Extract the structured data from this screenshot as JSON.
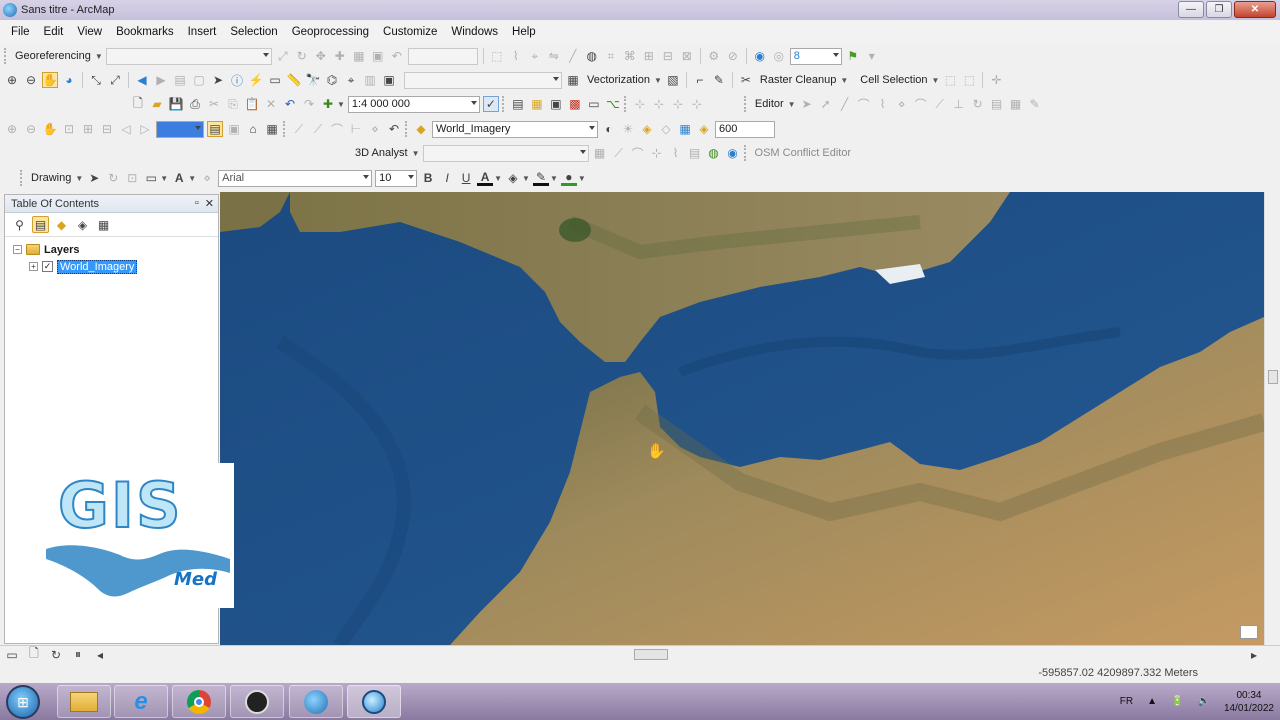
{
  "window": {
    "title": "Sans titre - ArcMap"
  },
  "menu": [
    "File",
    "Edit",
    "View",
    "Bookmarks",
    "Insert",
    "Selection",
    "Geoprocessing",
    "Customize",
    "Windows",
    "Help"
  ],
  "toolbars": {
    "georeferencing_label": "Georeferencing",
    "spin_value": "8",
    "vectorization_label": "Vectorization",
    "raster_cleanup_label": "Raster Cleanup",
    "cell_selection_label": "Cell Selection",
    "scale_value": "1:4 000 000",
    "editor_label": "Editor",
    "layer_combo_value": "World_Imagery",
    "resolution_value": "600",
    "analyst_3d_label": "3D Analyst",
    "osm_label": "OSM Conflict Editor",
    "drawing_label": "Drawing",
    "font_name": "Arial",
    "font_size": "10",
    "bold_label": "B",
    "italic_label": "I",
    "underline_label": "U",
    "font_color_label": "A"
  },
  "toc": {
    "title": "Table Of Contents",
    "root_label": "Layers",
    "layers": [
      {
        "name": "World_Imagery",
        "checked": true
      }
    ]
  },
  "logo": {
    "main": "GIS",
    "sub": "Med"
  },
  "status": {
    "coordinates": "-595857.02  4209897.332 Meters"
  },
  "taskbar": {
    "language": "FR",
    "time": "00:34",
    "date": "14/01/2022"
  },
  "colors": {
    "sea": "#1d4f85",
    "land": "#9c8a5e",
    "selection": "#3399ff",
    "accent": "#2f86c6"
  }
}
